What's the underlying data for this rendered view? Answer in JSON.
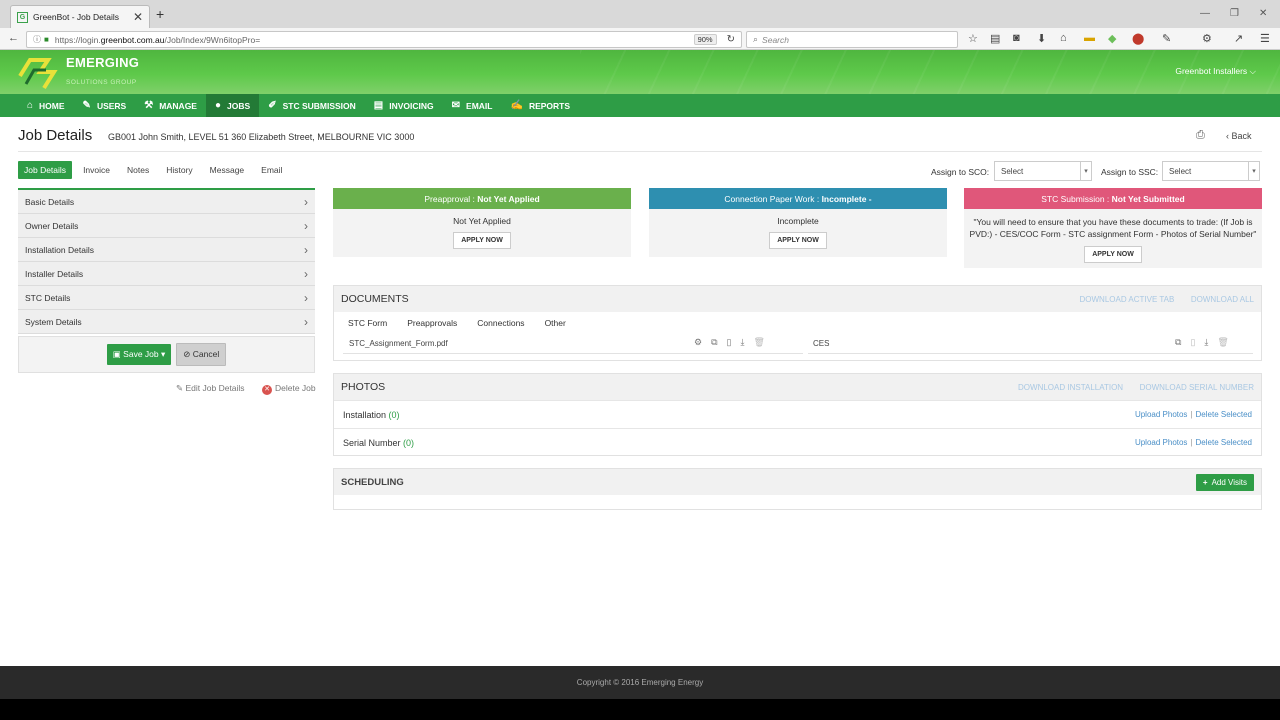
{
  "browser": {
    "tab_title": "GreenBot - Job Details",
    "favicon_letter": "G",
    "url_prefix": "https://login.",
    "url_domain": "greenbot.com.au",
    "url_path": "/Job/Index/9Wn6itopPro=",
    "zoom": "90%",
    "search_placeholder": "Search"
  },
  "brand": {
    "name": "EMERGING",
    "sub": "SOLUTIONS GROUP",
    "user": "Greenbot Installers"
  },
  "nav": {
    "items": [
      {
        "label": "HOME",
        "icon": "home-icon"
      },
      {
        "label": "USERS",
        "icon": "edit-icon"
      },
      {
        "label": "MANAGE",
        "icon": "wrench-icon"
      },
      {
        "label": "JOBS",
        "icon": "user-icon",
        "active": true
      },
      {
        "label": "STC SUBMISSION",
        "icon": "pencil-icon"
      },
      {
        "label": "INVOICING",
        "icon": "list-icon"
      },
      {
        "label": "EMAIL",
        "icon": "envelope-icon"
      },
      {
        "label": "REPORTS",
        "icon": "report-icon"
      }
    ]
  },
  "page": {
    "title": "Job Details",
    "job_address": "GB001 John Smith, LEVEL 51 360 Elizabeth Street, MELBOURNE VIC 3000",
    "back": "Back"
  },
  "subtabs": [
    "Job Details",
    "Invoice",
    "Notes",
    "History",
    "Message",
    "Email"
  ],
  "assign": {
    "sco_label": "Assign to SCO:",
    "sco_value": "Select",
    "ssc_label": "Assign to SSC:",
    "ssc_value": "Select"
  },
  "accordion": [
    "Basic Details",
    "Owner Details",
    "Installation Details",
    "Installer Details",
    "STC Details",
    "System Details"
  ],
  "actions": {
    "save": "Save Job",
    "cancel": "Cancel",
    "edit": "Edit Job Details",
    "delete": "Delete Job"
  },
  "cards": {
    "preapproval": {
      "label": "Preapproval : ",
      "status": "Not Yet Applied",
      "body": "Not Yet Applied",
      "button": "APPLY NOW",
      "color": "#6ab04c"
    },
    "connection": {
      "label": "Connection Paper Work : ",
      "status": "Incomplete -",
      "body": "Incomplete",
      "button": "APPLY NOW",
      "color": "#2e8fb0"
    },
    "stc": {
      "label": "STC Submission : ",
      "status": "Not Yet Submitted",
      "body": "\"You will need to ensure that you have these documents to trade: (If Job is PVD:) - CES/COC Form - STC assignment Form - Photos of Serial Number\"",
      "button": "APPLY NOW",
      "color": "#e0577a"
    }
  },
  "documents": {
    "title": "DOCUMENTS",
    "download_active": "DOWNLOAD ACTIVE TAB",
    "download_all": "DOWNLOAD ALL",
    "tabs": [
      "STC Form",
      "Preapprovals",
      "Connections",
      "Other"
    ],
    "files": [
      {
        "name": "STC_Assignment_Form.pdf"
      },
      {
        "name": "CES"
      }
    ]
  },
  "photos": {
    "title": "PHOTOS",
    "download_installation": "DOWNLOAD INSTALLATION",
    "download_serial": "DOWNLOAD SERIAL NUMBER",
    "rows": [
      {
        "label": "Installation",
        "count": "(0)",
        "upload": "Upload Photos",
        "delete": "Delete Selected"
      },
      {
        "label": "Serial Number",
        "count": "(0)",
        "upload": "Upload Photos",
        "delete": "Delete Selected"
      }
    ]
  },
  "scheduling": {
    "title": "SCHEDULING",
    "add": "Add Visits"
  },
  "footer": {
    "copyright": "Copyright © 2016 Emerging Energy"
  }
}
